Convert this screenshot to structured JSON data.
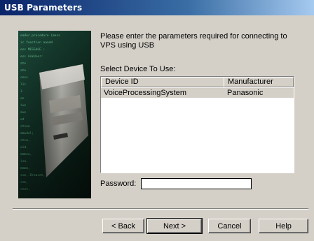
{
  "window": {
    "title": "USB Parameters"
  },
  "intro": {
    "line1": "Please enter the parameters required for connecting to",
    "line2": "VPS using USB"
  },
  "device_list": {
    "label": "Select Device To Use:",
    "columns": [
      "Device ID",
      "Manufacturer"
    ],
    "rows": [
      {
        "device_id": "VoiceProcessingSystem",
        "manufacturer": "Panasonic",
        "selected": true
      }
    ]
  },
  "password": {
    "label": "Password:",
    "value": ""
  },
  "buttons": {
    "back": "< Back",
    "next": "Next >",
    "cancel": "Cancel",
    "help": "Help"
  },
  "side_image": {
    "description_icon": "computer-tower-icon",
    "code_lines": [
      "eader procedure (mess",
      "ic function aaadd",
      "ess MESSAGE ;",
      "ess AskUser:",
      "ate",
      "ate",
      "cess",
      "lic",
      "3",
      "on",
      "ive",
      "ave",
      "ed",
      "ctsen",
      "mmodel;",
      "ctsa,",
      "eid,",
      "mmmon,",
      "isa,",
      "mmmm,",
      "ssm, Breaset,",
      "ssm,",
      "ctat,"
    ]
  }
}
